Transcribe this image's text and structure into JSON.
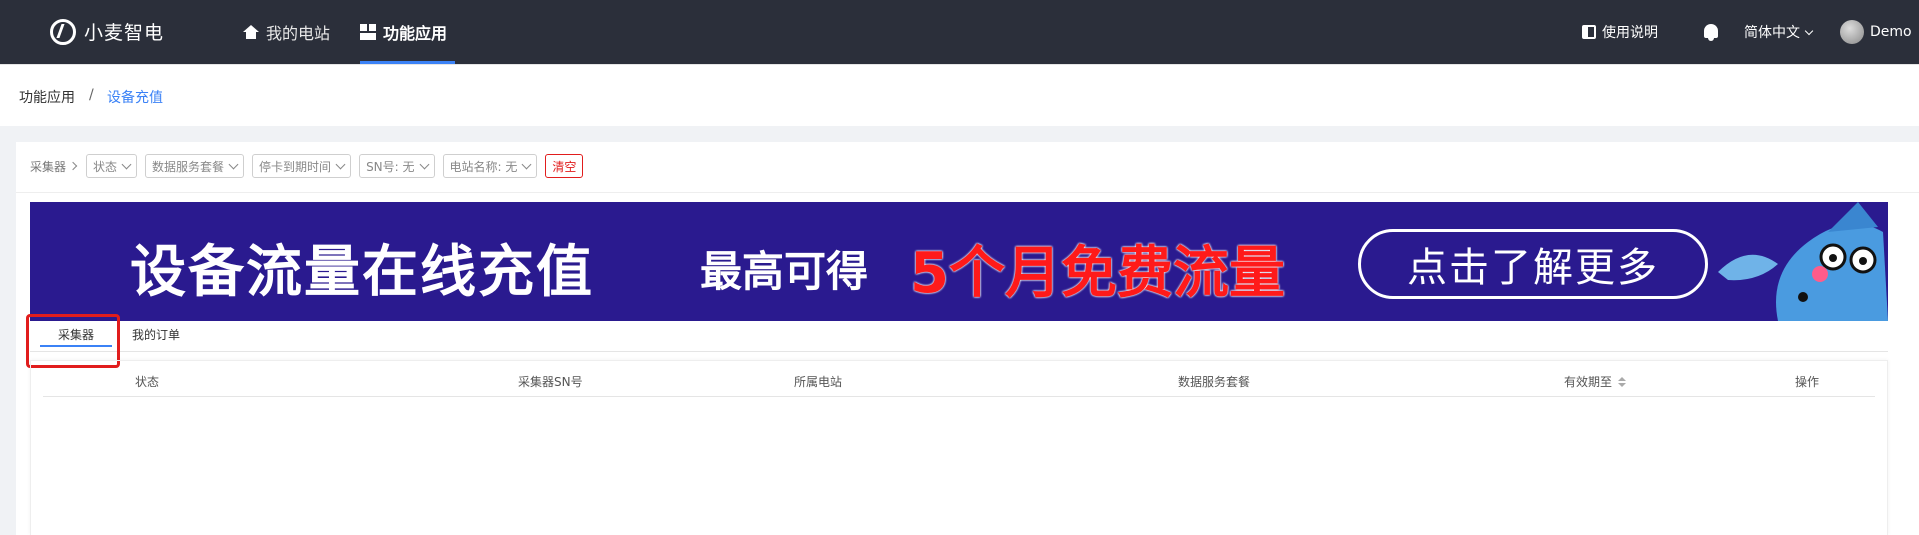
{
  "header": {
    "logo_text": "小麦智电",
    "nav": [
      {
        "label": "我的电站",
        "icon": "home-icon"
      },
      {
        "label": "功能应用",
        "icon": "apps-icon"
      }
    ],
    "help_label": "使用说明",
    "language": "简体中文",
    "username": "Demo"
  },
  "breadcrumb": {
    "parent": "功能应用",
    "separator": "/",
    "current": "设备充值"
  },
  "filters": {
    "collector_label": "采集器",
    "status": "状态",
    "package": "数据服务套餐",
    "expire": "停卡到期时间",
    "sn": "SN号: 无",
    "station": "电站名称: 无",
    "clear": "清空"
  },
  "banner": {
    "title": "设备流量在线充值",
    "subtitle": "最高可得",
    "highlight": "5个月免费流量",
    "button": "点击了解更多"
  },
  "tabs": [
    {
      "label": "采集器",
      "active": true
    },
    {
      "label": "我的订单",
      "active": false
    }
  ],
  "table": {
    "columns": [
      "状态",
      "采集器SN号",
      "所属电站",
      "数据服务套餐",
      "有效期至",
      "操作"
    ]
  },
  "colors": {
    "nav_bg": "#2b2f3a",
    "accent": "#3b82f6",
    "banner_bg": "#2a1a8f",
    "danger": "#e11d1d"
  }
}
